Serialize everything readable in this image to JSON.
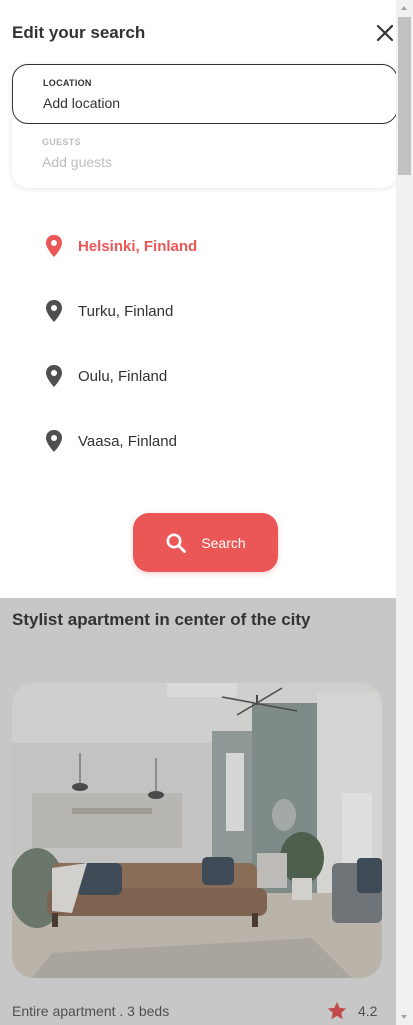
{
  "drawer": {
    "title": "Edit your search",
    "location_label": "LOCATION",
    "location_placeholder": "Add location",
    "guests_label": "GUESTS",
    "guests_placeholder": "Add guests"
  },
  "locations": [
    {
      "label": "Helsinki, Finland",
      "active": true
    },
    {
      "label": "Turku, Finland",
      "active": false
    },
    {
      "label": "Oulu, Finland",
      "active": false
    },
    {
      "label": "Vaasa, Finland",
      "active": false
    }
  ],
  "search_button": {
    "label": "Search"
  },
  "card": {
    "title": "Stylist apartment in center of the city",
    "meta": "Entire apartment . 3 beds",
    "rating": "4.2"
  },
  "colors": {
    "accent": "#eb5757",
    "text": "#333333",
    "muted": "#bdbdbd",
    "backdrop": "#c7c7c7"
  },
  "icons": {
    "close": "close-icon",
    "pin": "location-pin-icon",
    "search": "search-icon",
    "star": "star-icon"
  }
}
